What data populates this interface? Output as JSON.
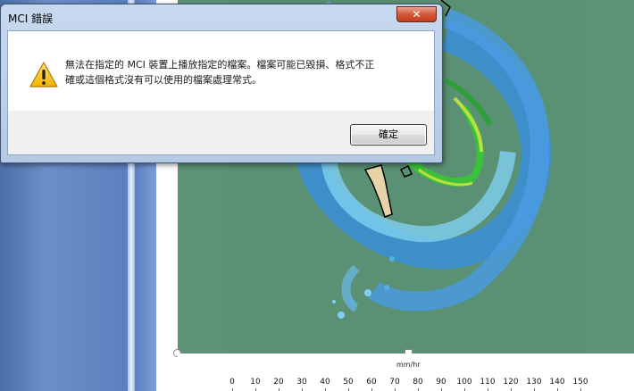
{
  "dialog": {
    "title": "MCI 錯誤",
    "close_glyph": "✕",
    "message_line1": "無法在指定的 MCI 裝置上播放指定的檔案。檔案可能已毀損、格式不正",
    "message_line2": "確或這個格式沒有可以使用的檔案處理常式。",
    "ok_label": "確定",
    "icon": "warning-icon"
  },
  "legend": {
    "unit": "mm/hr",
    "ticks": [
      "0",
      "10",
      "20",
      "30",
      "40",
      "50",
      "60",
      "70",
      "80",
      "90",
      "100",
      "110",
      "120",
      "130",
      "140",
      "150"
    ]
  },
  "colors": {
    "map_background": "#5d9276",
    "rain_light": "#3a8fd8",
    "rain_medium": "#7fd0f0",
    "rain_heavy": "#3cc23a",
    "rain_intense": "#b8e040"
  }
}
